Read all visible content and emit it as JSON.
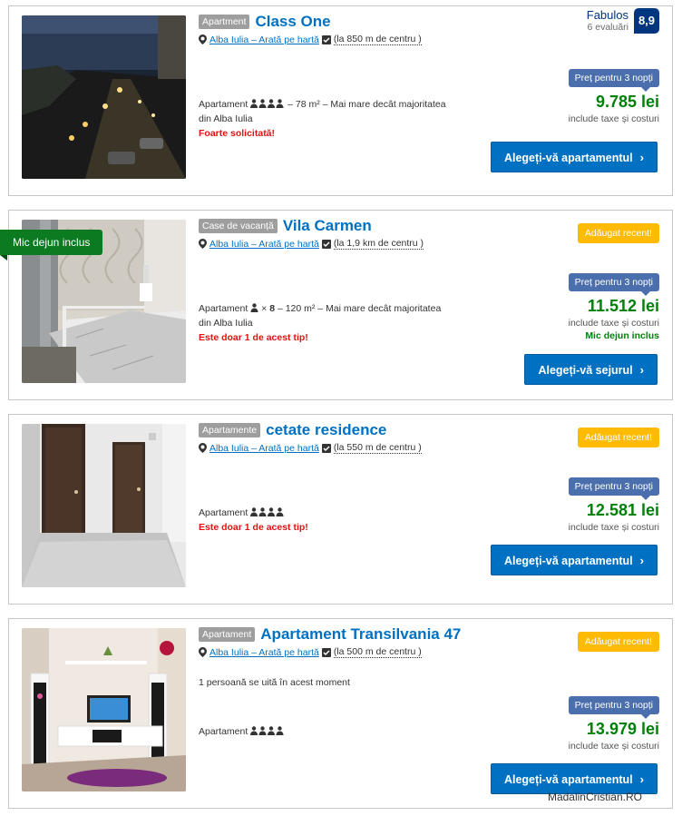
{
  "listings": [
    {
      "type": "Apartment",
      "name": "Class One",
      "location": "Alba Iulia – Arată pe hartă",
      "distance": "(la 850 m de centru )",
      "desc": "Apartament",
      "desc2": "– 78 m² – Mai mare decât majoritatea",
      "desc3": "din Alba Iulia",
      "alert": "Foarte solicitată!",
      "score_label": "Fabulos",
      "score_count": "6 evaluări",
      "score": "8,9",
      "price_note": "Preț pentru 3 nopți",
      "price": "9.785 lei",
      "tax": "include taxe și costuri",
      "cta": "Alegeți-vă apartamentul"
    },
    {
      "type": "Case de vacanță",
      "name": "Vila Carmen",
      "location": "Alba Iulia – Arată pe hartă",
      "distance": "(la 1,9 km de centru )",
      "desc": "Apartament",
      "desc_mult": "×",
      "desc_count": "8",
      "desc2": "– 120 m² – Mai mare decât majoritatea",
      "desc3": "din Alba Iulia",
      "alert": "Este doar 1 de acest tip!",
      "new_badge": "Adăugat recent!",
      "price_note": "Preț pentru 3 nopți",
      "price": "11.512 lei",
      "tax": "include taxe și costuri",
      "breakfast": "Mic dejun inclus",
      "cta": "Alegeți-vă sejurul",
      "ribbon": "Mic dejun inclus"
    },
    {
      "type": "Apartamente",
      "name": "cetate residence",
      "location": "Alba Iulia – Arată pe hartă",
      "distance": "(la 550 m de centru )",
      "desc": "Apartament",
      "alert": "Este doar 1 de acest tip!",
      "new_badge": "Adăugat recent!",
      "price_note": "Preț pentru 3 nopți",
      "price": "12.581 lei",
      "tax": "include taxe și costuri",
      "cta": "Alegeți-vă apartamentul"
    },
    {
      "type": "Apartament",
      "name": "Apartament Transilvania 47",
      "location": "Alba Iulia – Arată pe hartă",
      "distance": "(la 500 m de centru )",
      "viewers": "1 persoană se uită în acest moment",
      "desc": "Apartament",
      "new_badge": "Adăugat recent!",
      "price_note": "Preț pentru 3 nopți",
      "price": "13.979 lei",
      "tax": "include taxe și costuri",
      "cta": "Alegeți-vă apartamentul"
    }
  ],
  "watermark": "MadalinCristian.RO",
  "colors": {
    "link": "#0071c2",
    "price": "#008009",
    "alert": "#e21111",
    "badge": "#febb02",
    "ribbon": "#0b7a21",
    "score": "#003580"
  }
}
